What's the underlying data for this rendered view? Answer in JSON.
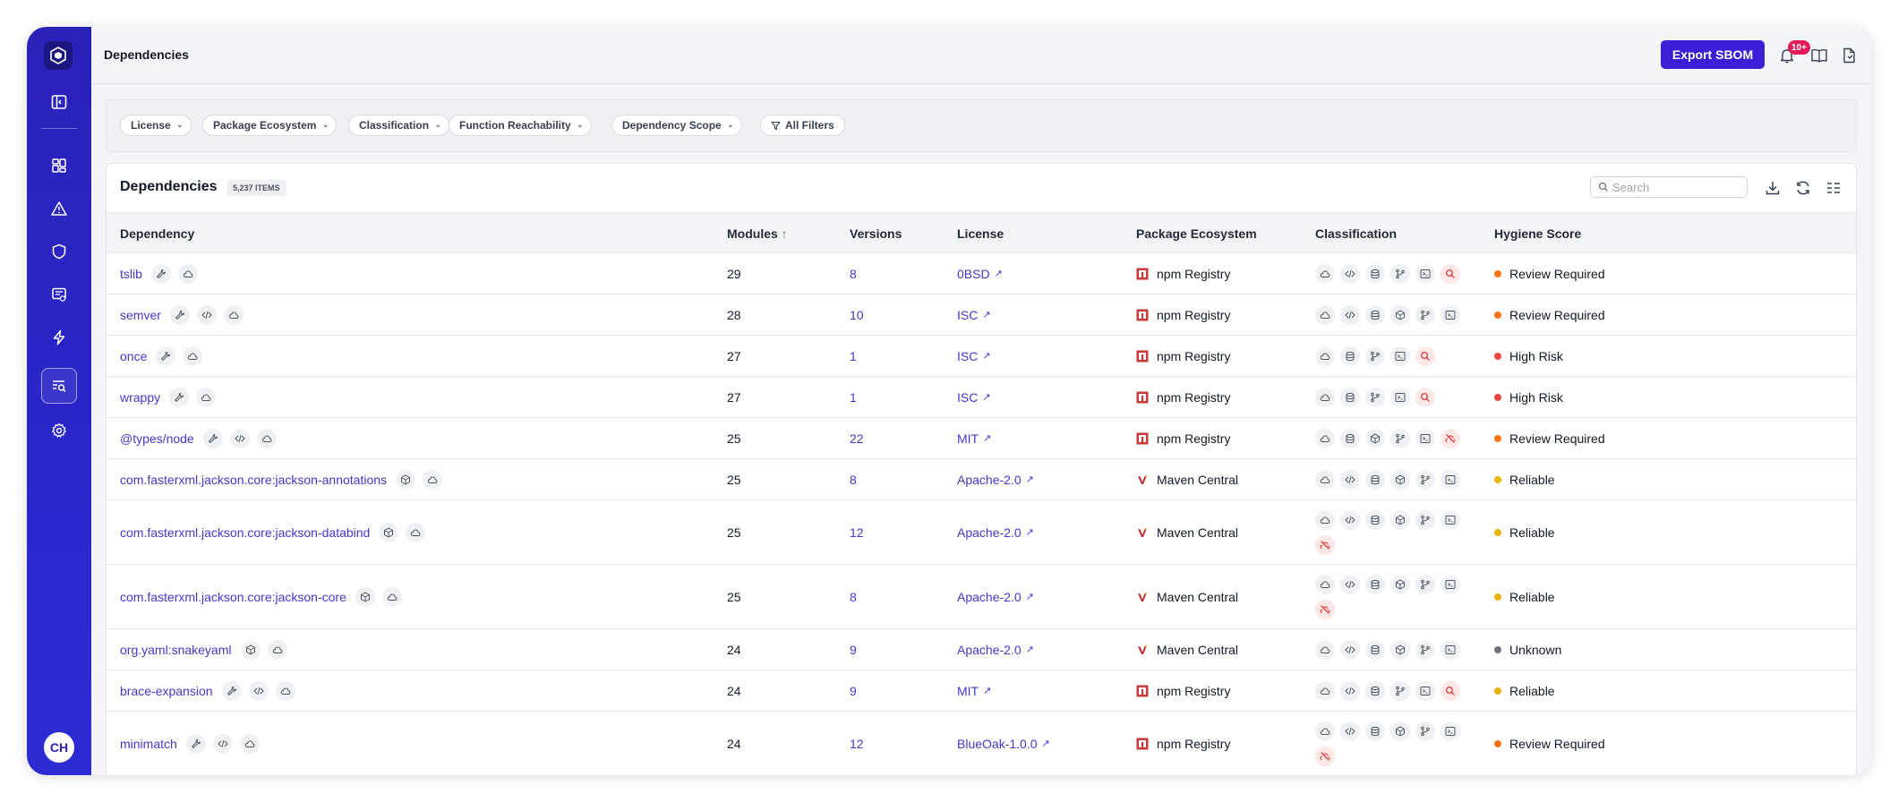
{
  "page": {
    "title": "Dependencies"
  },
  "topbar": {
    "export_label": "Export SBOM",
    "notif_badge": "10+"
  },
  "sidebar": {
    "items": [
      {
        "name": "sidebar-item-toggle",
        "icon": "panel-icon"
      },
      {
        "name": "sidebar-item-dashboard",
        "icon": "grid-icon"
      },
      {
        "name": "sidebar-item-alerts",
        "icon": "warning-icon"
      },
      {
        "name": "sidebar-item-security",
        "icon": "shield-icon"
      },
      {
        "name": "sidebar-item-reports",
        "icon": "report-icon"
      },
      {
        "name": "sidebar-item-automation",
        "icon": "bolt-icon"
      },
      {
        "name": "sidebar-item-dependencies",
        "icon": "list-search-icon"
      },
      {
        "name": "sidebar-item-settings",
        "icon": "gear-icon"
      }
    ],
    "avatar": "CH"
  },
  "filters": [
    {
      "label": "License"
    },
    {
      "label": "Package Ecosystem"
    },
    {
      "label": "Classification"
    },
    {
      "label": "Function Reachability"
    },
    {
      "label": "Dependency Scope"
    },
    {
      "label": "All Filters"
    }
  ],
  "table": {
    "title": "Dependencies",
    "count": "5,237 ITEMS",
    "search_placeholder": "Search",
    "columns": {
      "dependency": "Dependency",
      "modules": "Modules",
      "sort_arrow": "↑",
      "versions": "Versions",
      "license": "License",
      "ecosystem": "Package Ecosystem",
      "classification": "Classification",
      "hygiene": "Hygiene Score"
    },
    "rows": [
      {
        "name": "tslib",
        "tags": [
          "wrench",
          "cloud"
        ],
        "modules": "29",
        "versions": "8",
        "license": "0BSD",
        "eco": "npm Registry",
        "eco_type": "npm",
        "cls": [
          "cloud",
          "code",
          "db",
          "branch",
          "terminal",
          "search-red"
        ],
        "hygiene": "Review Required",
        "hcolor": "#f97316"
      },
      {
        "name": "semver",
        "tags": [
          "wrench",
          "code",
          "cloud"
        ],
        "modules": "28",
        "versions": "10",
        "license": "ISC",
        "eco": "npm Registry",
        "eco_type": "npm",
        "cls": [
          "cloud",
          "code",
          "db",
          "cube",
          "branch",
          "terminal"
        ],
        "hygiene": "Review Required",
        "hcolor": "#f97316"
      },
      {
        "name": "once",
        "tags": [
          "wrench",
          "cloud"
        ],
        "modules": "27",
        "versions": "1",
        "license": "ISC",
        "eco": "npm Registry",
        "eco_type": "npm",
        "cls": [
          "cloud",
          "db",
          "branch",
          "terminal",
          "search-red"
        ],
        "hygiene": "High Risk",
        "hcolor": "#ef4444"
      },
      {
        "name": "wrappy",
        "tags": [
          "wrench",
          "cloud"
        ],
        "modules": "27",
        "versions": "1",
        "license": "ISC",
        "eco": "npm Registry",
        "eco_type": "npm",
        "cls": [
          "cloud",
          "db",
          "branch",
          "terminal",
          "search-red"
        ],
        "hygiene": "High Risk",
        "hcolor": "#ef4444"
      },
      {
        "name": "@types/node",
        "tags": [
          "wrench",
          "code",
          "cloud"
        ],
        "modules": "25",
        "versions": "22",
        "license": "MIT",
        "eco": "npm Registry",
        "eco_type": "npm",
        "cls": [
          "cloud",
          "db",
          "cube",
          "branch",
          "terminal",
          "off-red"
        ],
        "hygiene": "Review Required",
        "hcolor": "#f97316"
      },
      {
        "name": "com.fasterxml.jackson.core:jackson-annotations",
        "tags": [
          "cube",
          "cloud"
        ],
        "modules": "25",
        "versions": "8",
        "license": "Apache-2.0",
        "eco": "Maven Central",
        "eco_type": "maven",
        "cls": [
          "cloud",
          "code",
          "db",
          "cube",
          "branch",
          "terminal"
        ],
        "hygiene": "Reliable",
        "hcolor": "#eab308"
      },
      {
        "name": "com.fasterxml.jackson.core:jackson-databind",
        "tags": [
          "cube",
          "cloud"
        ],
        "modules": "25",
        "versions": "12",
        "license": "Apache-2.0",
        "eco": "Maven Central",
        "eco_type": "maven",
        "cls": [
          "cloud",
          "code",
          "db",
          "cube",
          "branch",
          "terminal",
          "off-red"
        ],
        "hygiene": "Reliable",
        "hcolor": "#eab308"
      },
      {
        "name": "com.fasterxml.jackson.core:jackson-core",
        "tags": [
          "cube",
          "cloud"
        ],
        "modules": "25",
        "versions": "8",
        "license": "Apache-2.0",
        "eco": "Maven Central",
        "eco_type": "maven",
        "cls": [
          "cloud",
          "code",
          "db",
          "cube",
          "branch",
          "terminal",
          "off-red"
        ],
        "hygiene": "Reliable",
        "hcolor": "#eab308"
      },
      {
        "name": "org.yaml:snakeyaml",
        "tags": [
          "cube",
          "cloud"
        ],
        "modules": "24",
        "versions": "9",
        "license": "Apache-2.0",
        "eco": "Maven Central",
        "eco_type": "maven",
        "cls": [
          "cloud",
          "code",
          "db",
          "cube",
          "branch",
          "terminal"
        ],
        "hygiene": "Unknown",
        "hcolor": "#6b7280"
      },
      {
        "name": "brace-expansion",
        "tags": [
          "wrench",
          "code",
          "cloud"
        ],
        "modules": "24",
        "versions": "9",
        "license": "MIT",
        "eco": "npm Registry",
        "eco_type": "npm",
        "cls": [
          "cloud",
          "code",
          "db",
          "branch",
          "terminal",
          "search-red"
        ],
        "hygiene": "Reliable",
        "hcolor": "#eab308"
      },
      {
        "name": "minimatch",
        "tags": [
          "wrench",
          "code",
          "cloud"
        ],
        "modules": "24",
        "versions": "12",
        "license": "BlueOak-1.0.0",
        "eco": "npm Registry",
        "eco_type": "npm",
        "cls": [
          "cloud",
          "code",
          "db",
          "cube",
          "branch",
          "terminal",
          "off-red"
        ],
        "hygiene": "Review Required",
        "hcolor": "#f97316"
      }
    ]
  }
}
